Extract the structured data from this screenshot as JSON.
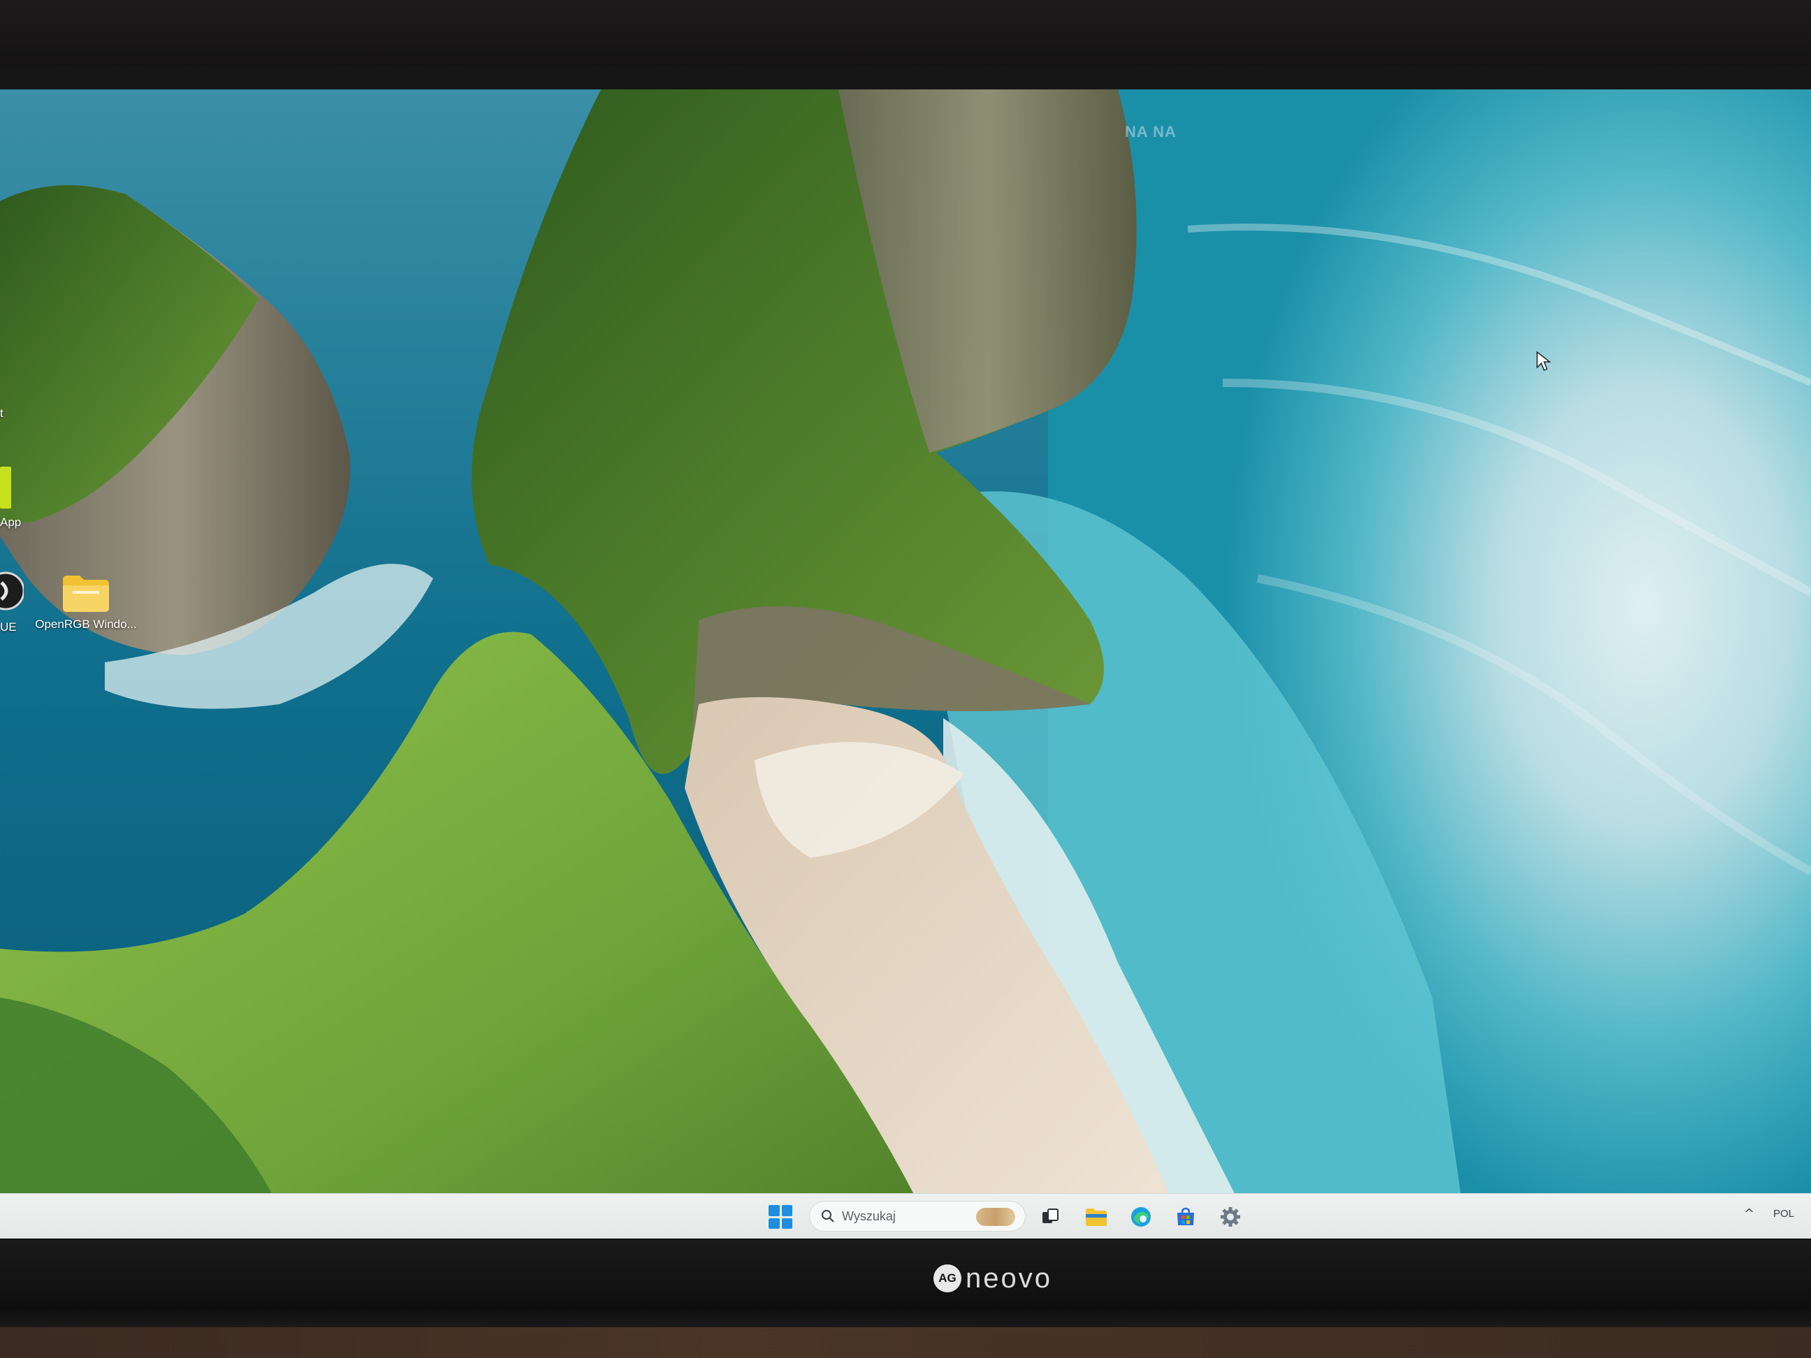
{
  "monitor": {
    "brand_badge": "AG",
    "brand_name": "neovo"
  },
  "desktop": {
    "widget_text": "NA NA",
    "icons": [
      {
        "label": "OpenRGB Windo...",
        "icon": "folder-icon"
      }
    ],
    "edge_labels": {
      "top_left": "t",
      "app": "App",
      "icue": "UE"
    }
  },
  "taskbar": {
    "start_icon": "windows-start-icon",
    "search_placeholder": "Wyszukaj",
    "apps": [
      "task-view-icon",
      "file-explorer-icon",
      "edge-browser-icon",
      "microsoft-store-icon",
      "settings-icon"
    ],
    "tray_chevron": "^",
    "language": "POL",
    "colors": {
      "start_blue": "#1f8ee0",
      "folder_yellow": "#f4c430",
      "edge_blue": "#1aa0e0",
      "store_blue": "#2a6fd6"
    }
  }
}
